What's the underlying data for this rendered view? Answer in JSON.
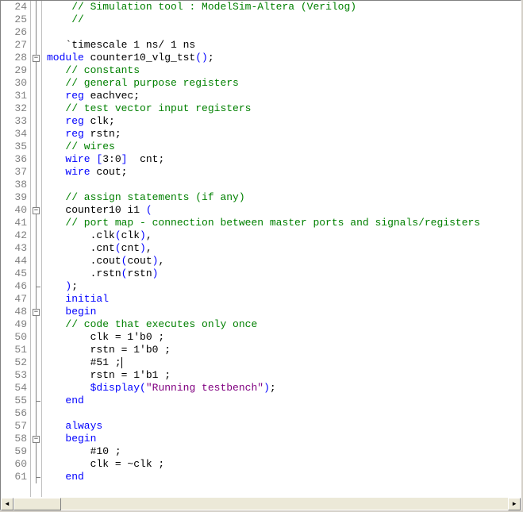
{
  "editor": {
    "lines": [
      {
        "num": 24,
        "fold": "line",
        "tokens": [
          [
            "    ",
            "d"
          ],
          [
            "// Simulation tool : ModelSim-Altera (Verilog)",
            "c"
          ]
        ]
      },
      {
        "num": 25,
        "fold": "line",
        "tokens": [
          [
            "    ",
            "d"
          ],
          [
            "//",
            "c"
          ]
        ]
      },
      {
        "num": 26,
        "fold": "line",
        "tokens": []
      },
      {
        "num": 27,
        "fold": "line",
        "tokens": [
          [
            "   ",
            "d"
          ],
          [
            "`timescale 1 ns/ 1 ns",
            "d"
          ]
        ]
      },
      {
        "num": 28,
        "fold": "box",
        "tokens": [
          [
            "module",
            "k"
          ],
          [
            " counter10_vlg_tst",
            "d"
          ],
          [
            "()",
            "k"
          ],
          [
            ";",
            "d"
          ]
        ]
      },
      {
        "num": 29,
        "fold": "line",
        "tokens": [
          [
            "   ",
            "d"
          ],
          [
            "// constants",
            "c"
          ]
        ]
      },
      {
        "num": 30,
        "fold": "line",
        "tokens": [
          [
            "   ",
            "d"
          ],
          [
            "// general purpose registers",
            "c"
          ]
        ]
      },
      {
        "num": 31,
        "fold": "line",
        "tokens": [
          [
            "   ",
            "d"
          ],
          [
            "reg",
            "k"
          ],
          [
            " eachvec;",
            "d"
          ]
        ]
      },
      {
        "num": 32,
        "fold": "line",
        "tokens": [
          [
            "   ",
            "d"
          ],
          [
            "// test vector input registers",
            "c"
          ]
        ]
      },
      {
        "num": 33,
        "fold": "line",
        "tokens": [
          [
            "   ",
            "d"
          ],
          [
            "reg",
            "k"
          ],
          [
            " clk;",
            "d"
          ]
        ]
      },
      {
        "num": 34,
        "fold": "line",
        "tokens": [
          [
            "   ",
            "d"
          ],
          [
            "reg",
            "k"
          ],
          [
            " rstn;",
            "d"
          ]
        ]
      },
      {
        "num": 35,
        "fold": "line",
        "tokens": [
          [
            "   ",
            "d"
          ],
          [
            "// wires",
            "c"
          ]
        ]
      },
      {
        "num": 36,
        "fold": "line",
        "tokens": [
          [
            "   ",
            "d"
          ],
          [
            "wire",
            "k"
          ],
          [
            " ",
            "d"
          ],
          [
            "[",
            "k"
          ],
          [
            "3:0",
            "d"
          ],
          [
            "]",
            "k"
          ],
          [
            "  cnt;",
            "d"
          ]
        ]
      },
      {
        "num": 37,
        "fold": "line",
        "tokens": [
          [
            "   ",
            "d"
          ],
          [
            "wire",
            "k"
          ],
          [
            " cout;",
            "d"
          ]
        ]
      },
      {
        "num": 38,
        "fold": "line",
        "tokens": []
      },
      {
        "num": 39,
        "fold": "line",
        "tokens": [
          [
            "   ",
            "d"
          ],
          [
            "// assign statements (if any)",
            "c"
          ]
        ]
      },
      {
        "num": 40,
        "fold": "box",
        "tokens": [
          [
            "   counter10 i1 ",
            "d"
          ],
          [
            "(",
            "k"
          ]
        ]
      },
      {
        "num": 41,
        "fold": "line",
        "tokens": [
          [
            "   ",
            "d"
          ],
          [
            "// port map - connection between master ports and signals/registers",
            "c"
          ]
        ]
      },
      {
        "num": 42,
        "fold": "line",
        "tokens": [
          [
            "       .clk",
            "d"
          ],
          [
            "(",
            "k"
          ],
          [
            "clk",
            "d"
          ],
          [
            ")",
            "k"
          ],
          [
            ",",
            "d"
          ]
        ]
      },
      {
        "num": 43,
        "fold": "line",
        "tokens": [
          [
            "       .cnt",
            "d"
          ],
          [
            "(",
            "k"
          ],
          [
            "cnt",
            "d"
          ],
          [
            ")",
            "k"
          ],
          [
            ",",
            "d"
          ]
        ]
      },
      {
        "num": 44,
        "fold": "line",
        "tokens": [
          [
            "       .cout",
            "d"
          ],
          [
            "(",
            "k"
          ],
          [
            "cout",
            "d"
          ],
          [
            ")",
            "k"
          ],
          [
            ",",
            "d"
          ]
        ]
      },
      {
        "num": 45,
        "fold": "line",
        "tokens": [
          [
            "       .rstn",
            "d"
          ],
          [
            "(",
            "k"
          ],
          [
            "rstn",
            "d"
          ],
          [
            ")",
            "k"
          ]
        ]
      },
      {
        "num": 46,
        "fold": "end",
        "tokens": [
          [
            "   ",
            "d"
          ],
          [
            ")",
            "k"
          ],
          [
            ";",
            "d"
          ]
        ]
      },
      {
        "num": 47,
        "fold": "line",
        "tokens": [
          [
            "   ",
            "d"
          ],
          [
            "initial",
            "k"
          ]
        ]
      },
      {
        "num": 48,
        "fold": "box",
        "tokens": [
          [
            "   ",
            "d"
          ],
          [
            "begin",
            "k"
          ]
        ]
      },
      {
        "num": 49,
        "fold": "line",
        "tokens": [
          [
            "   ",
            "d"
          ],
          [
            "// code that executes only once",
            "c"
          ]
        ]
      },
      {
        "num": 50,
        "fold": "line",
        "tokens": [
          [
            "       clk = 1'b0 ;",
            "d"
          ]
        ]
      },
      {
        "num": 51,
        "fold": "line",
        "tokens": [
          [
            "       rstn = 1'b0 ;",
            "d"
          ]
        ]
      },
      {
        "num": 52,
        "fold": "line",
        "tokens": [
          [
            "       #51 ;",
            "d"
          ]
        ],
        "caret": true
      },
      {
        "num": 53,
        "fold": "line",
        "tokens": [
          [
            "       rstn = 1'b1 ;",
            "d"
          ]
        ]
      },
      {
        "num": 54,
        "fold": "line",
        "tokens": [
          [
            "       ",
            "d"
          ],
          [
            "$display",
            "k"
          ],
          [
            "(",
            "k"
          ],
          [
            "\"Running testbench\"",
            "s"
          ],
          [
            ")",
            "k"
          ],
          [
            ";",
            "d"
          ]
        ]
      },
      {
        "num": 55,
        "fold": "end",
        "tokens": [
          [
            "   ",
            "d"
          ],
          [
            "end",
            "k"
          ]
        ]
      },
      {
        "num": 56,
        "fold": "line",
        "tokens": []
      },
      {
        "num": 57,
        "fold": "line",
        "tokens": [
          [
            "   ",
            "d"
          ],
          [
            "always",
            "k"
          ]
        ]
      },
      {
        "num": 58,
        "fold": "box",
        "tokens": [
          [
            "   ",
            "d"
          ],
          [
            "begin",
            "k"
          ]
        ]
      },
      {
        "num": 59,
        "fold": "line",
        "tokens": [
          [
            "       #10 ;",
            "d"
          ]
        ]
      },
      {
        "num": 60,
        "fold": "line",
        "tokens": [
          [
            "       clk = ~clk ;",
            "d"
          ]
        ]
      },
      {
        "num": 61,
        "fold": "end",
        "tokens": [
          [
            "   ",
            "d"
          ],
          [
            "end",
            "k"
          ]
        ]
      }
    ],
    "fold_glyph": "−"
  },
  "scrollbar": {
    "left_arrow": "◄",
    "right_arrow": "►"
  },
  "colors": {
    "comment": "#008000",
    "keyword": "#0000ff",
    "string": "#800080",
    "default": "#000000",
    "gutter_text": "#808080"
  }
}
